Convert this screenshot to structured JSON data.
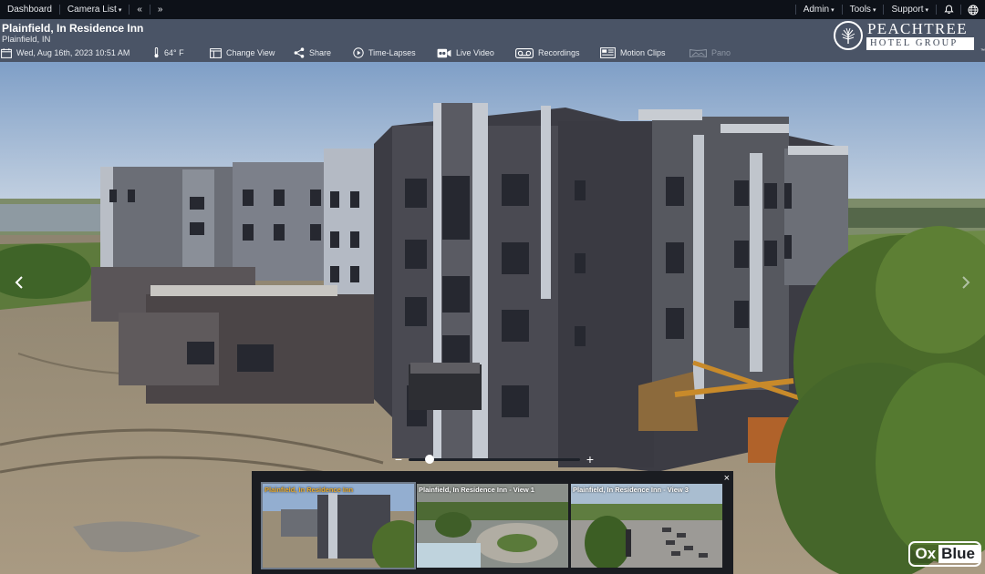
{
  "topnav": {
    "left": [
      {
        "label": "Dashboard"
      },
      {
        "label": "Camera List",
        "caret": true
      }
    ],
    "back_label": "«",
    "forward_label": "»",
    "right": [
      {
        "label": "Admin",
        "caret": true
      },
      {
        "label": "Tools",
        "caret": true
      },
      {
        "label": "Support",
        "caret": true
      }
    ]
  },
  "header": {
    "title": "Plainfield, In Residence Inn",
    "subtitle": "Plainfield, IN",
    "datetime": "Wed, Aug 16th, 2023 10:51 AM",
    "temperature": "64° F",
    "actions": {
      "change_view": "Change View",
      "share": "Share",
      "time_lapses": "Time-Lapses",
      "live_video": "Live Video",
      "recordings": "Recordings",
      "motion_clips": "Motion Clips",
      "pano": "Pano"
    }
  },
  "brand": {
    "name": "PEACHTREE",
    "sub": "HOTEL GROUP",
    "tm": "™"
  },
  "viewer": {
    "zoom_minus": "−",
    "zoom_plus": "+",
    "zoom_level": 0.1
  },
  "thumbnails": {
    "close": "×",
    "items": [
      {
        "label": "Plainfield, In Residence Inn",
        "active": true
      },
      {
        "label": "Plainfield, In Residence Inn - View 1",
        "active": false
      },
      {
        "label": "Plainfield, In Residence Inn - View 3",
        "active": false
      }
    ]
  },
  "logo": {
    "ox": "Ox",
    "blue": "Blue"
  },
  "colors": {
    "topnav_bg": "#0d1118",
    "header_bg": "#4a5466",
    "active_thumb_label": "#e8a828"
  }
}
